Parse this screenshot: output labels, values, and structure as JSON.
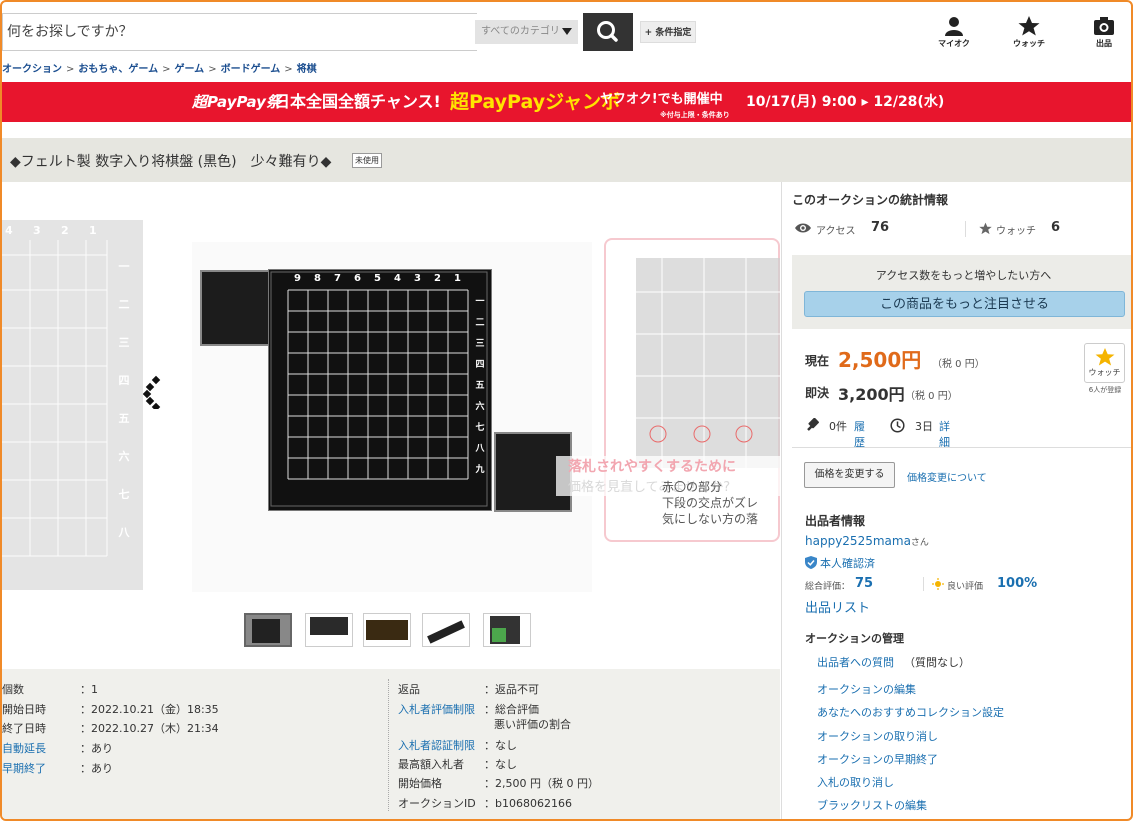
{
  "header": {
    "search_placeholder": "何をお探しですか？",
    "category_label": "すべてのカテゴリ",
    "condition_button": "+ 条件指定",
    "icons": [
      {
        "name": "user-icon",
        "label": "マイオク"
      },
      {
        "name": "star-icon",
        "label": "ウォッチ"
      },
      {
        "name": "camera-icon",
        "label": "出品"
      }
    ]
  },
  "breadcrumb": [
    "オークション",
    "おもちゃ、ゲーム",
    "ゲーム",
    "ボードゲーム",
    "将棋"
  ],
  "banner": {
    "logo": "超PayPay祭",
    "headline": "日本全国全額チャンス!",
    "campaign": "超PayPayジャンボ",
    "sub": "ヤフオク!でも開催中",
    "note": "※付与上限・条件あり",
    "dates": "10/17(月) 9:00 ▸ 12/28(水)"
  },
  "item": {
    "title": "◆フェルト製 数字入り将棋盤 (黒色)　少々難有り◆",
    "condition_badge": "未使用",
    "board_cols": [
      "9",
      "8",
      "7",
      "6",
      "5",
      "4",
      "3",
      "2",
      "1"
    ],
    "board_rows": [
      "一",
      "二",
      "三",
      "四",
      "五",
      "六",
      "七",
      "八",
      "九"
    ],
    "left_board_cols": [
      "4",
      "3",
      "2",
      "1"
    ],
    "right_overlay": [
      "落札されやすくするために",
      "価格を見直してみませんか?",
      "赤〇の部分",
      "下段の交点がズレ",
      "気にしない方の落"
    ]
  },
  "details_left": [
    {
      "label": "個数",
      "value": "1",
      "link": false
    },
    {
      "label": "開始日時",
      "value": "2022.10.21（金）18:35",
      "link": false
    },
    {
      "label": "終了日時",
      "value": "2022.10.27（木）21:34",
      "link": false
    },
    {
      "label": "自動延長",
      "value": "あり",
      "link": true
    },
    {
      "label": "早期終了",
      "value": "あり",
      "link": true
    }
  ],
  "details_right": [
    {
      "label": "返品",
      "value": "返品不可",
      "value2": "",
      "link": false
    },
    {
      "label": "入札者評価制限",
      "value": "総合評価",
      "value2": "悪い評価の割合",
      "link": true
    },
    {
      "label": "入札者認証制限",
      "value": "なし",
      "value2": "",
      "link": true
    },
    {
      "label": "最高額入札者",
      "value": "なし",
      "value2": "",
      "link": false
    },
    {
      "label": "開始価格",
      "value": "2,500 円（税 0 円）",
      "value2": "",
      "link": false
    },
    {
      "label": "オークションID",
      "value": "b1068062166",
      "value2": "",
      "link": false
    }
  ],
  "stats": {
    "heading": "このオークションの統計情報",
    "access_label": "アクセス",
    "access_value": "76",
    "watch_label": "ウォッチ",
    "watch_value": "6"
  },
  "promo": {
    "text": "アクセス数をもっと増やしたい方へ",
    "button": "この商品をもっと注目させる"
  },
  "price": {
    "current_label": "現在",
    "current_value": "2,500円",
    "current_tax": "（税 0 円）",
    "buyout_label": "即決",
    "buyout_value": "3,200円",
    "buyout_tax": "（税 0 円）",
    "watch_button": "ウォッチ",
    "watch_count": "6人が登録",
    "bids": "0件",
    "history_link": "履歴",
    "time_left": "3日",
    "detail_link": "詳細"
  },
  "price_change": {
    "button": "価格を変更する",
    "link": "価格変更について"
  },
  "seller": {
    "heading": "出品者情報",
    "name": "happy2525mama",
    "suffix": "さん",
    "verified": "本人確認済",
    "total_label": "総合評価：",
    "total_value": "75",
    "good_label": "良い評価",
    "good_value": "100%",
    "list_link": "出品リスト"
  },
  "management": {
    "heading": "オークションの管理",
    "questions": "出品者への質問",
    "questions_note": "（質問なし）",
    "items": [
      "オークションの編集",
      "あなたへのおすすめコレクション設定",
      "オークションの取り消し",
      "オークションの早期終了",
      "入札の取り消し",
      "ブラックリストの編集"
    ]
  },
  "colors": {
    "frame": "#f08a28",
    "banner": "#e8152d",
    "price": "#e06a1a",
    "link": "#1a6fb0"
  }
}
